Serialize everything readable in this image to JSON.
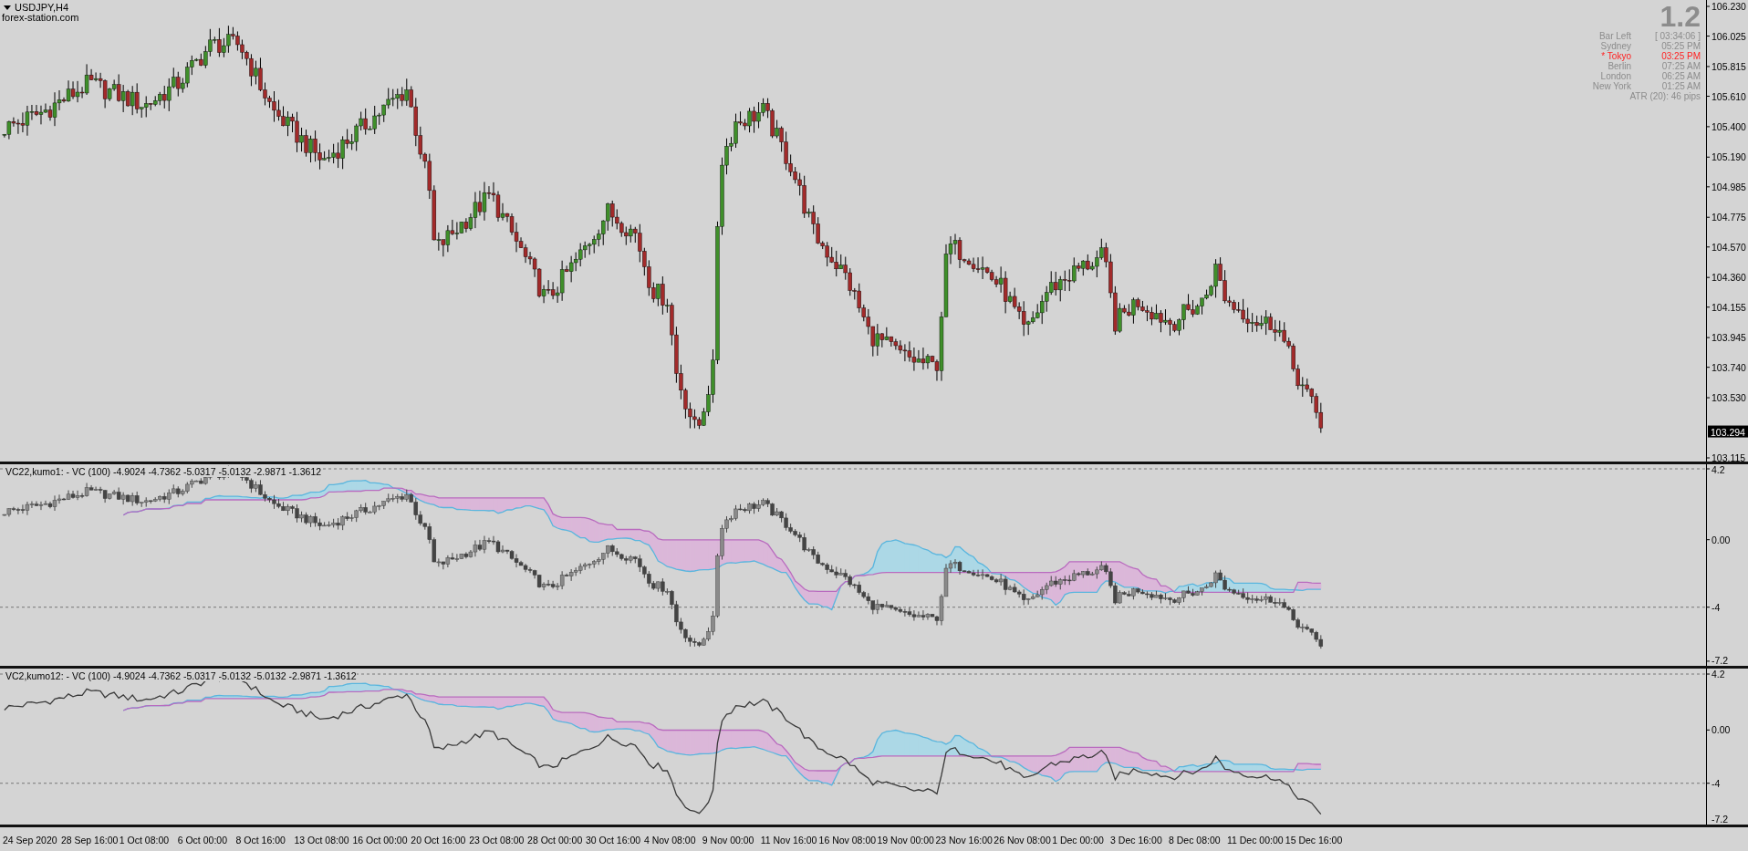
{
  "chart": {
    "symbol": "USDJPY,H4",
    "source": "forex-station.com",
    "price_axis": [
      "106.230",
      "106.025",
      "105.815",
      "105.610",
      "105.400",
      "105.190",
      "104.985",
      "104.775",
      "104.570",
      "104.360",
      "104.155",
      "103.945",
      "103.740",
      "103.530",
      "103.115"
    ],
    "current_price": "103.294"
  },
  "info_panel": {
    "version": "1.2",
    "rows": [
      {
        "label": "Bar Left",
        "value": "[ 03:34:06 ]",
        "highlighted": false
      },
      {
        "label": "Sydney",
        "value": "05:25 PM",
        "highlighted": false
      },
      {
        "label": "* Tokyo",
        "value": "03:25 PM",
        "highlighted": true
      },
      {
        "label": "Berlin",
        "value": "07:25 AM",
        "highlighted": false
      },
      {
        "label": "London",
        "value": "06:25 AM",
        "highlighted": false
      },
      {
        "label": "New York",
        "value": "01:25 AM",
        "highlighted": false
      }
    ],
    "atr": "ATR (20): 46 pips"
  },
  "subwindows": [
    {
      "label": "VC22,kumo1: - VC (100) -4.9024 -4.7362 -5.0317 -5.0132 -2.9871 -1.3612",
      "kind": "candles",
      "axis": [
        "4.2",
        "0.00",
        "-4",
        "-7.2"
      ]
    },
    {
      "label": "VC2,kumo12: - VC (100) -4.9024 -4.7362 -5.0317 -5.0132 -5.0132 -2.9871 -1.3612",
      "kind": "line",
      "axis": [
        "4.2",
        "0.00",
        "-4",
        "-7.2"
      ]
    }
  ],
  "time_axis": [
    "24 Sep 2020",
    "28 Sep 16:00",
    "1 Oct 08:00",
    "6 Oct 00:00",
    "8 Oct 16:00",
    "13 Oct 08:00",
    "16 Oct 00:00",
    "20 Oct 16:00",
    "23 Oct 08:00",
    "28 Oct 00:00",
    "30 Oct 16:00",
    "4 Nov 08:00",
    "9 Nov 00:00",
    "11 Nov 16:00",
    "16 Nov 08:00",
    "19 Nov 00:00",
    "23 Nov 16:00",
    "26 Nov 08:00",
    "1 Dec 00:00",
    "3 Dec 16:00",
    "8 Dec 08:00",
    "11 Dec 00:00",
    "15 Dec 16:00"
  ]
}
